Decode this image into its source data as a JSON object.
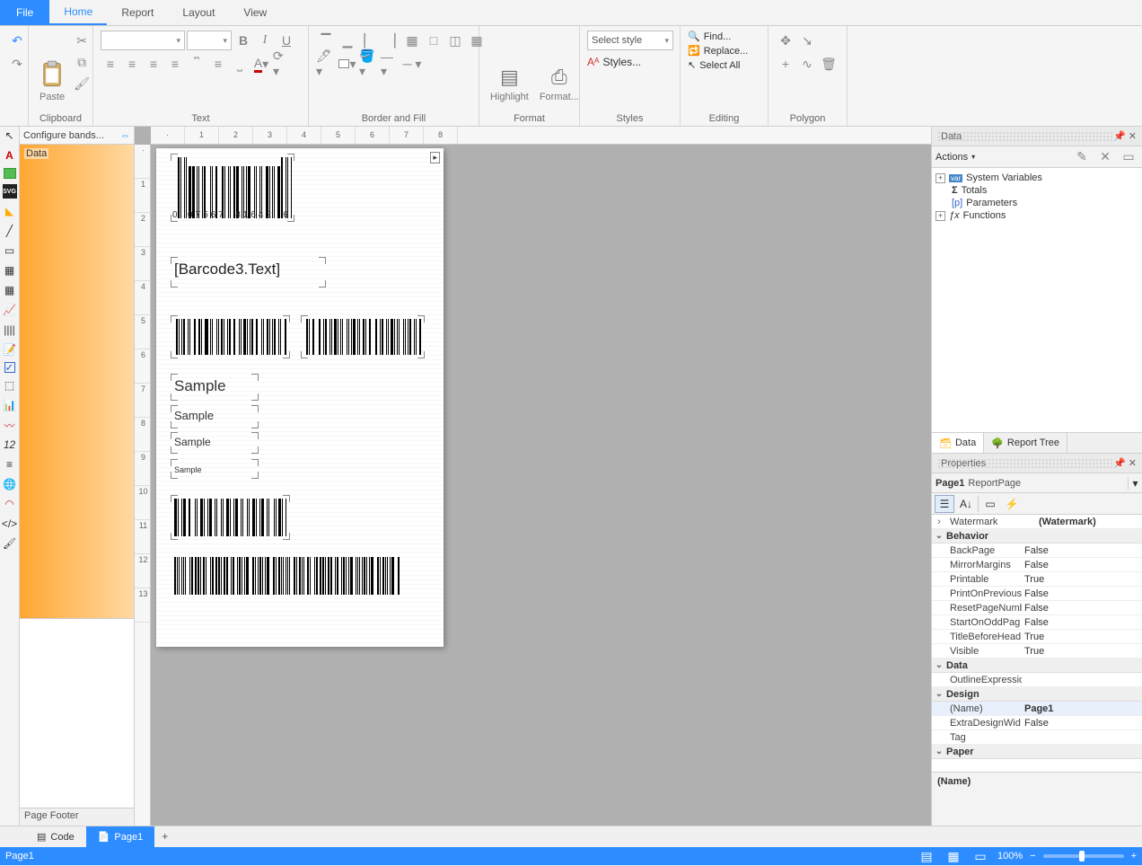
{
  "menus": {
    "file": "File",
    "home": "Home",
    "report": "Report",
    "layout": "Layout",
    "view": "View"
  },
  "ribbon": {
    "clipboard": {
      "label": "Clipboard",
      "paste": "Paste"
    },
    "text": {
      "label": "Text",
      "bold": "B",
      "italic": "I",
      "underline": "U"
    },
    "border": {
      "label": "Border and Fill"
    },
    "format": {
      "label": "Format",
      "highlight": "Highlight",
      "formatBtn": "Format..."
    },
    "styles": {
      "label": "Styles",
      "select": "Select style",
      "stylesBtn": "Styles..."
    },
    "editing": {
      "label": "Editing",
      "find": "Find...",
      "replace": "Replace...",
      "selectAll": "Select All"
    },
    "polygon": {
      "label": "Polygon"
    }
  },
  "bands": {
    "configure": "Configure bands...",
    "data": "Data",
    "footer": "Page Footer"
  },
  "canvas": {
    "barcodeDigits": {
      "d0": "0",
      "d1": "07567",
      "d2": "81642",
      "d3": "6"
    },
    "placeholder": "[Barcode3.Text]",
    "samples": [
      "Sample",
      "Sample",
      "Sample",
      "Sample"
    ]
  },
  "rightPanels": {
    "data": "Data",
    "actions": "Actions",
    "tree": {
      "sysvar": "System Variables",
      "totals": "Totals",
      "params": "Parameters",
      "functions": "Functions"
    },
    "tabs": {
      "data": "Data",
      "reportTree": "Report Tree"
    },
    "properties": "Properties",
    "obj": {
      "name": "Page1",
      "type": "ReportPage"
    },
    "rows": {
      "watermark": {
        "k": "Watermark",
        "v": "(Watermark)"
      },
      "behavior": "Behavior",
      "backpage": {
        "k": "BackPage",
        "v": "False"
      },
      "mirror": {
        "k": "MirrorMargins",
        "v": "False"
      },
      "printable": {
        "k": "Printable",
        "v": "True"
      },
      "printon": {
        "k": "PrintOnPrevious",
        "v": "False"
      },
      "reset": {
        "k": "ResetPageNumb",
        "v": "False"
      },
      "startodd": {
        "k": "StartOnOddPag",
        "v": "False"
      },
      "titlebefore": {
        "k": "TitleBeforeHead",
        "v": "True"
      },
      "visible": {
        "k": "Visible",
        "v": "True"
      },
      "dataCat": "Data",
      "outline": {
        "k": "OutlineExpressio",
        "v": ""
      },
      "designCat": "Design",
      "name": {
        "k": "(Name)",
        "v": "Page1"
      },
      "extra": {
        "k": "ExtraDesignWid",
        "v": "False"
      },
      "tag": {
        "k": "Tag",
        "v": ""
      },
      "paperCat": "Paper"
    },
    "help": "(Name)"
  },
  "bottomTabs": {
    "code": "Code",
    "page1": "Page1"
  },
  "status": {
    "page": "Page1",
    "zoom": "100%"
  }
}
